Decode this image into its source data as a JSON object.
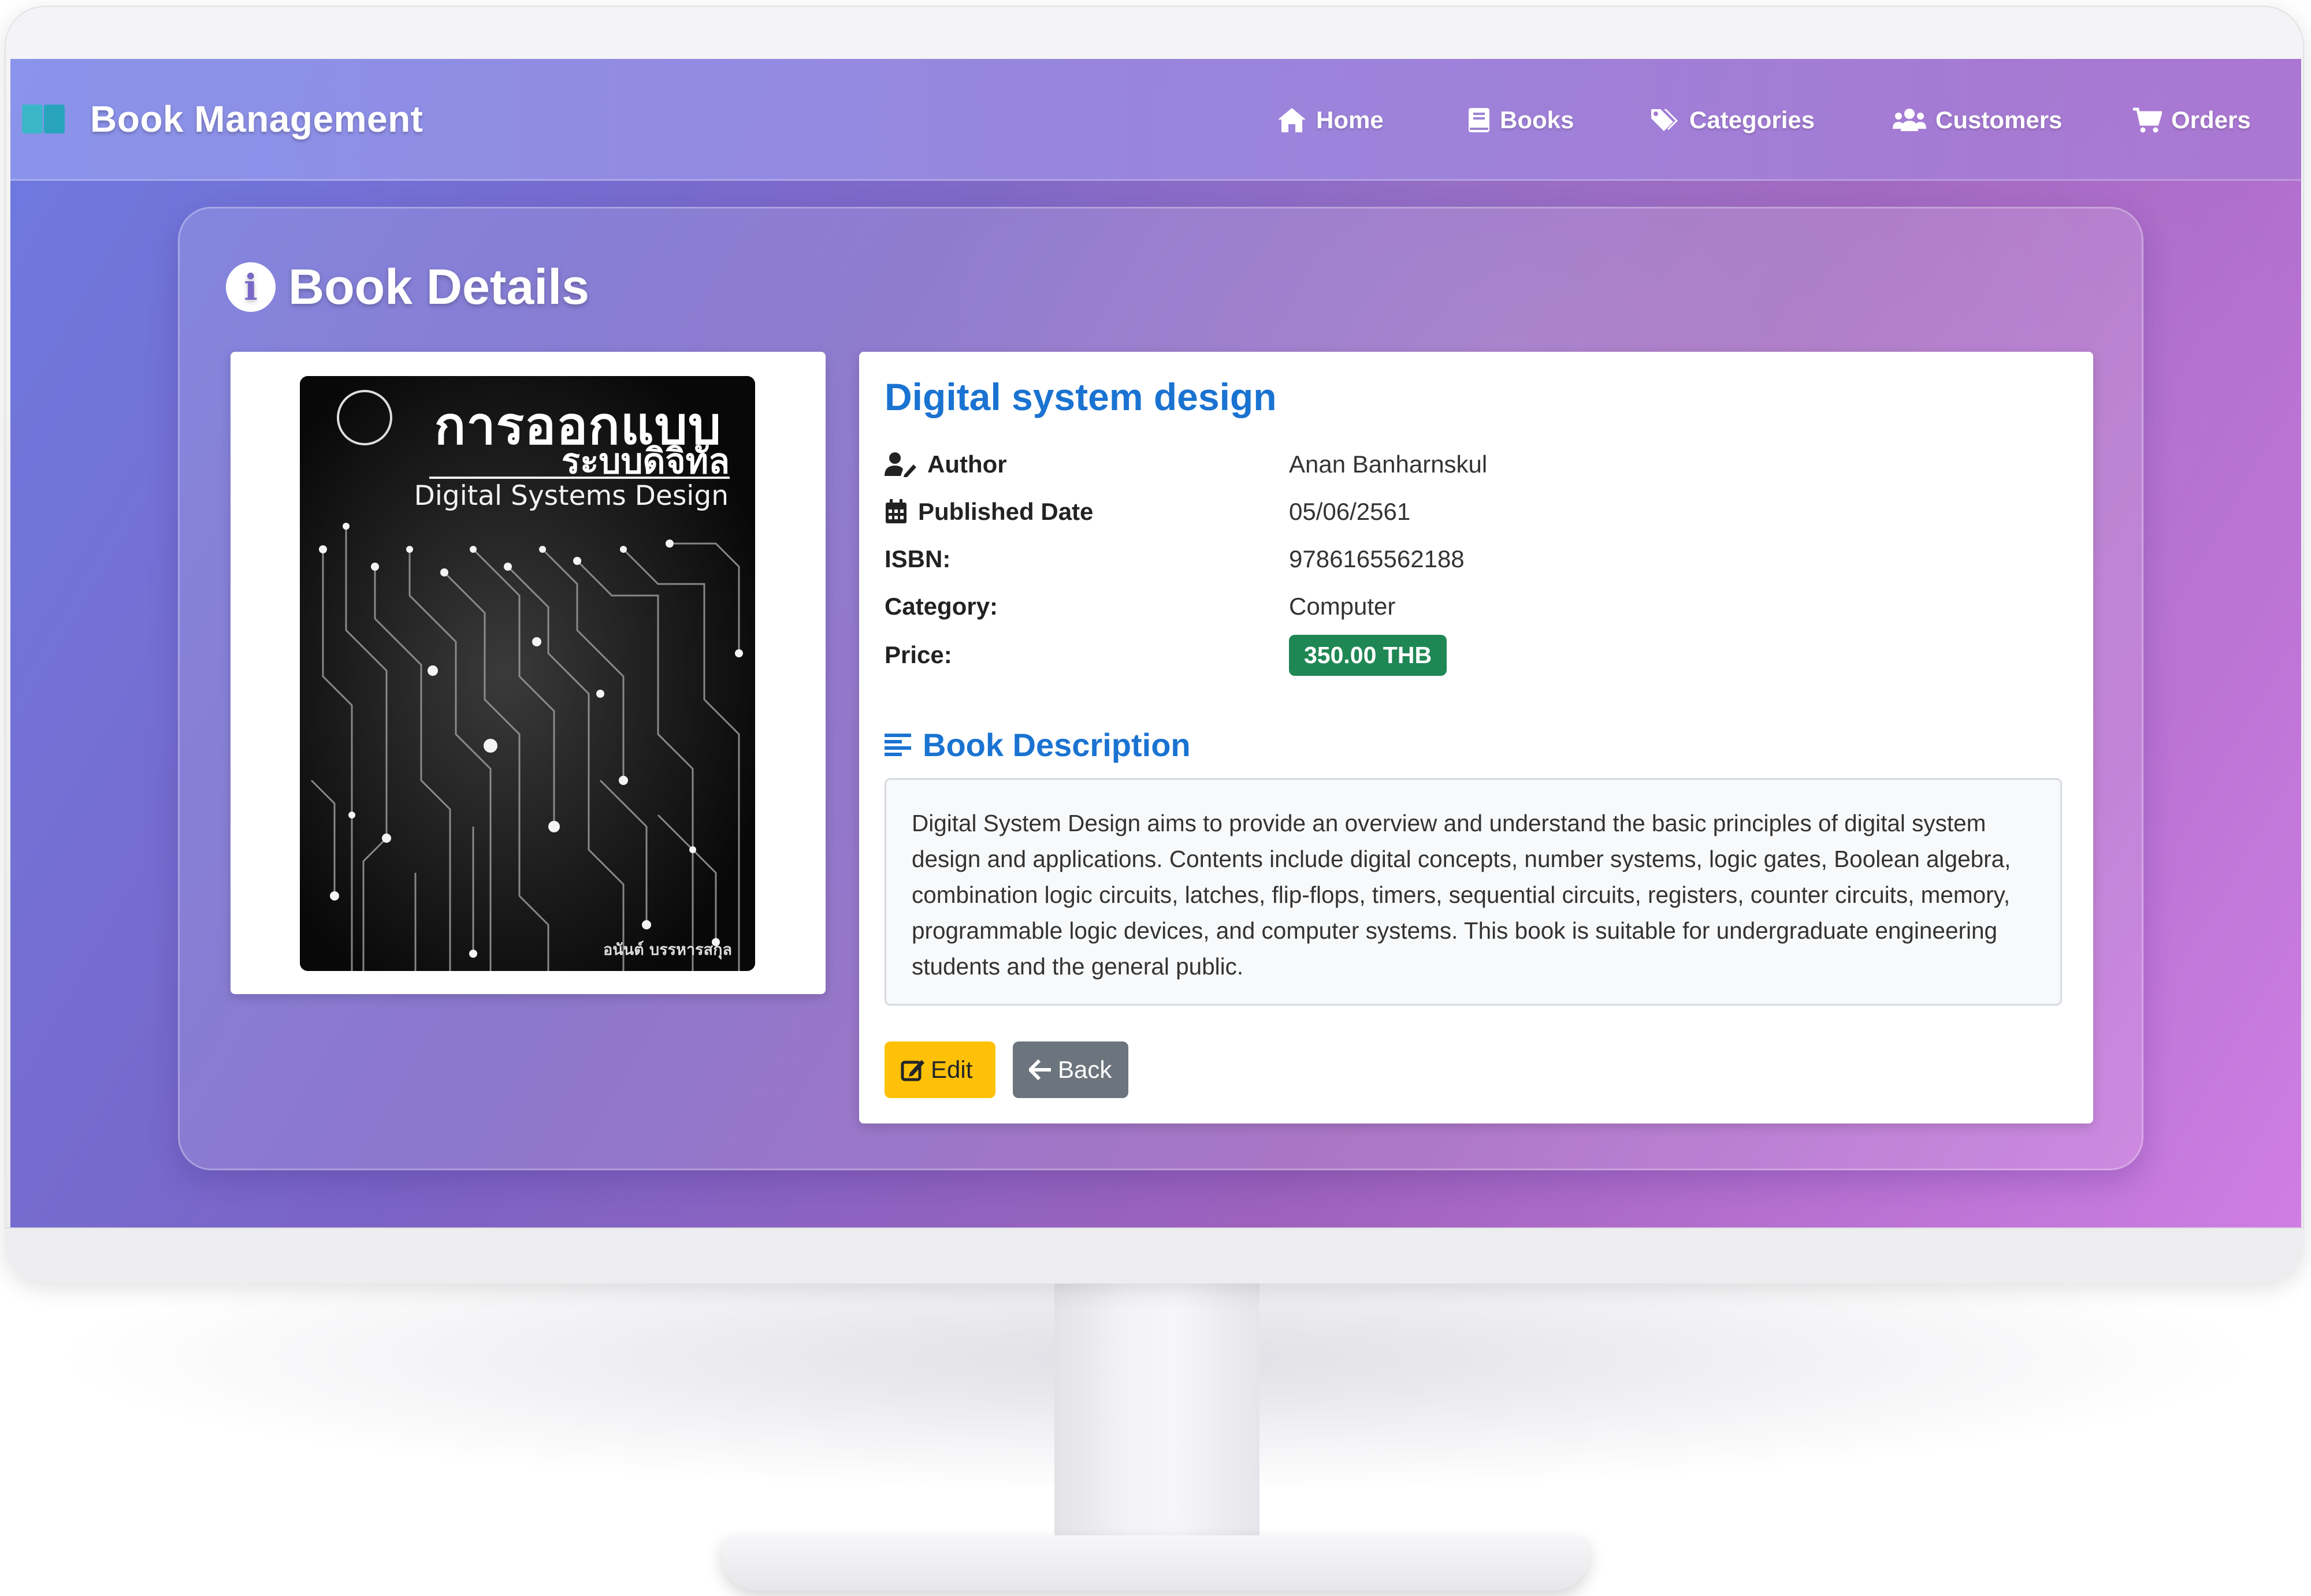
{
  "app": {
    "brand_title": "Book Management",
    "nav": [
      {
        "label": "Home",
        "icon": "home-icon"
      },
      {
        "label": "Books",
        "icon": "book-icon"
      },
      {
        "label": "Categories",
        "icon": "tags-icon"
      },
      {
        "label": "Customers",
        "icon": "users-icon"
      },
      {
        "label": "Orders",
        "icon": "cart-icon"
      }
    ]
  },
  "page": {
    "heading": "Book Details",
    "heading_icon": "info-icon"
  },
  "cover": {
    "title_th_line1": "การออกแบบ",
    "title_th_line2": "ระบบดิจิทัล",
    "title_en": "Digital Systems Design",
    "author_th": "อนันต์ บรรหารสกุล"
  },
  "book": {
    "title": "Digital system design",
    "fields": {
      "author": {
        "label": "Author",
        "value": "Anan Banharnskul",
        "icon": "user-pen-icon"
      },
      "published_date": {
        "label": "Published Date",
        "value": "05/06/2561",
        "icon": "calendar-icon"
      },
      "isbn": {
        "label": "ISBN:",
        "value": "9786165562188"
      },
      "category": {
        "label": "Category:",
        "value": "Computer"
      },
      "price": {
        "label": "Price:",
        "value": "350.00 THB"
      }
    },
    "description_heading": "Book Description",
    "description_icon": "align-left-icon",
    "description": "Digital System Design aims to provide an overview and understand the basic principles of digital system design and applications. Contents include digital concepts, number systems, logic gates, Boolean algebra, combination logic circuits, latches, flip-flops, timers, sequential circuits, registers, counter circuits, memory, programmable logic devices, and computer systems. This book is suitable for undergraduate engineering students and the general public."
  },
  "actions": {
    "edit_label": "Edit",
    "back_label": "Back"
  },
  "colors": {
    "accent_blue": "#1a73d1",
    "price_badge": "#1f8754",
    "edit_button": "#ffc107",
    "back_button": "#6c757d"
  }
}
